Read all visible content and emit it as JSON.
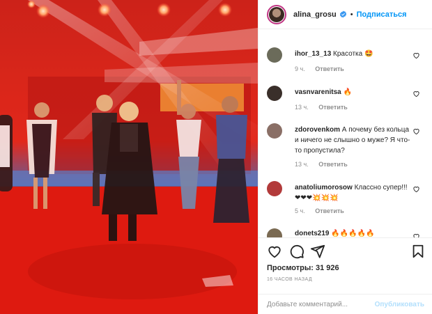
{
  "post": {
    "media_alt": "",
    "header": {
      "username": "alina_grosu",
      "follow_label": "Подписаться",
      "dot": "•"
    },
    "comments": [
      {
        "user": "ihor_13_13",
        "text": "Красотка 🤩",
        "time": "9 ч.",
        "reply": "Ответить",
        "avatar_color": "#6b6b5a"
      },
      {
        "user": "vasnvarenitsa",
        "text": "🔥",
        "time": "13 ч.",
        "reply": "Ответить",
        "avatar_color": "#3a2f2a"
      },
      {
        "user": "zdorovenkom",
        "text": "А почему без кольца и ничего не слышно о муже? Я что-то пропустила?",
        "time": "13 ч.",
        "reply": "Ответить",
        "avatar_color": "#8a6f66"
      },
      {
        "user": "anatoliumorosow",
        "text": "Классно супер!!!❤❤❤💥💥💥",
        "time": "5 ч.",
        "reply": "Ответить",
        "avatar_color": "#b23a3a"
      },
      {
        "user": "donets219",
        "text": "🔥🔥🔥🔥🔥",
        "time": "",
        "reply": "",
        "avatar_color": "#7a6a52"
      }
    ],
    "views": "Просмотры: 31 926",
    "time_ago": "16 часов назад",
    "add_comment_placeholder": "Добавьте комментарий...",
    "publish_label": "Опубликовать"
  },
  "colors": {
    "link_blue": "#0095f6",
    "muted": "#8e8e8e",
    "stage_red": "#d9190f"
  },
  "icons": [
    "verified-badge-icon",
    "heart-icon",
    "comment-icon",
    "share-icon",
    "bookmark-icon",
    "small-heart-icon"
  ]
}
